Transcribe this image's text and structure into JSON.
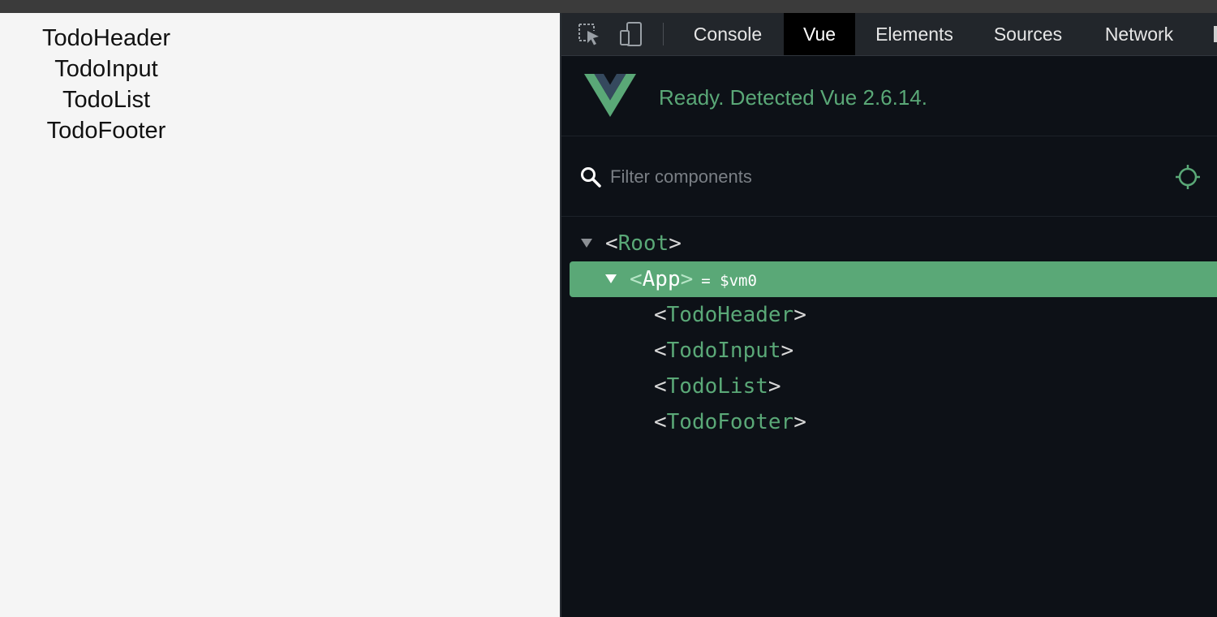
{
  "page": {
    "components": [
      "TodoHeader",
      "TodoInput",
      "TodoList",
      "TodoFooter"
    ]
  },
  "devtools": {
    "tabs": [
      {
        "label": "Console",
        "active": false
      },
      {
        "label": "Vue",
        "active": true
      },
      {
        "label": "Elements",
        "active": false
      },
      {
        "label": "Sources",
        "active": false
      },
      {
        "label": "Network",
        "active": false
      }
    ],
    "icons": {
      "inspect": "inspect-element-icon",
      "device": "device-toolbar-icon",
      "search": "search-icon",
      "select": "select-component-icon"
    }
  },
  "vue": {
    "status": "Ready. Detected Vue 2.6.14.",
    "filter_placeholder": "Filter components",
    "tree": {
      "root": {
        "open": "<",
        "name": "Root",
        "close": ">"
      },
      "app": {
        "open": "<",
        "name": "App",
        "close": ">",
        "vm": "= $vm0"
      },
      "children": [
        {
          "open": "<",
          "name": "TodoHeader",
          "close": ">"
        },
        {
          "open": "<",
          "name": "TodoInput",
          "close": ">"
        },
        {
          "open": "<",
          "name": "TodoList",
          "close": ">"
        },
        {
          "open": "<",
          "name": "TodoFooter",
          "close": ">"
        }
      ]
    }
  },
  "colors": {
    "vue_green": "#5aa877",
    "panel_bg": "#0d1117",
    "page_bg": "#f5f5f5"
  }
}
